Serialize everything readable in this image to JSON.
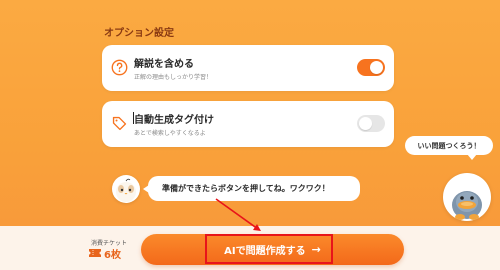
{
  "section": {
    "title": "オプション設定"
  },
  "options": [
    {
      "title": "解説を含める",
      "desc": "正解の理由もしっかり学習！",
      "icon": "question-circle-icon",
      "enabled": true
    },
    {
      "title": "自動生成タグ付け",
      "desc": "あとで検索しやすくなるよ",
      "icon": "tag-icon",
      "enabled": false
    }
  ],
  "bubbles": {
    "right": "いい問題つくろう！",
    "left": "準備ができたらボタンを押してね。ワクワク！"
  },
  "footer": {
    "ticket_label": "消費チケット",
    "ticket_count": "6枚",
    "ticket_icon": "ticket-icon",
    "cta_label": "AIで問題作成する",
    "cta_arrow": "→"
  },
  "colors": {
    "accent": "#f7731f",
    "background": "#f9a13a",
    "annotation": "#e8141a"
  }
}
